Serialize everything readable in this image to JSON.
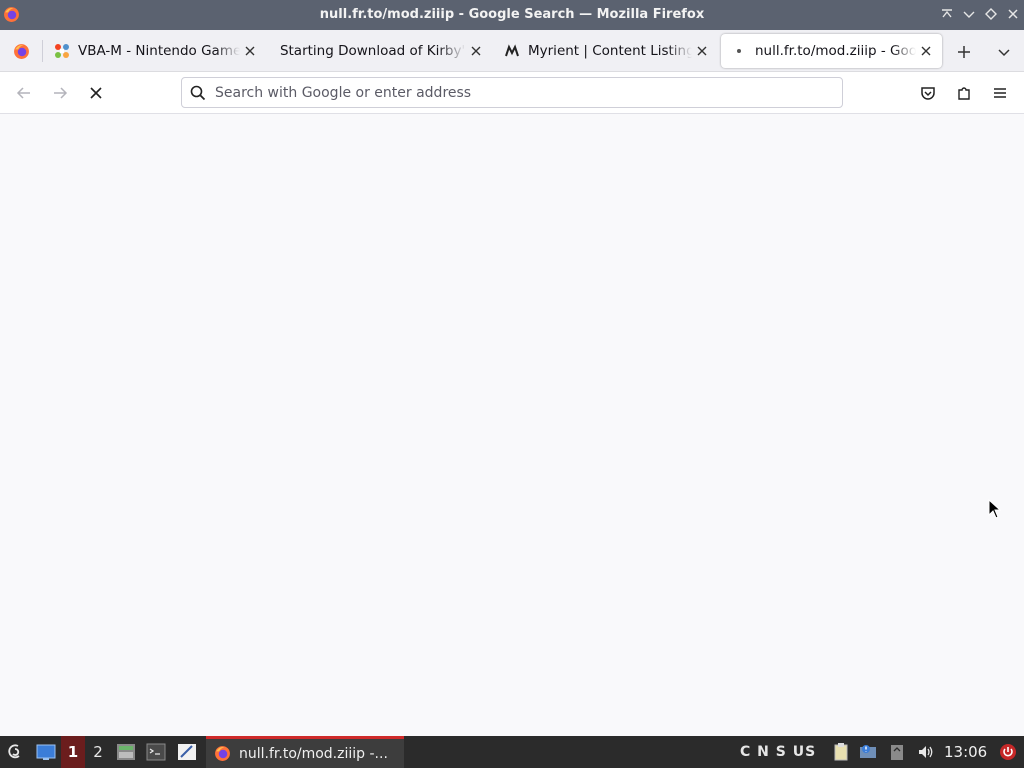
{
  "window": {
    "title": "null.fr.to/mod.ziiip - Google Search — Mozilla Firefox"
  },
  "tabs": [
    {
      "label": "VBA-M - Nintendo GameBoy",
      "icon": "joomla-icon",
      "active": false
    },
    {
      "label": "Starting Download of Kirby's",
      "icon": "none",
      "active": false
    },
    {
      "label": "Myrient | Content Listing",
      "icon": "myrient-icon",
      "active": false
    },
    {
      "label": "null.fr.to/mod.ziiip - Google",
      "icon": "loading-dot-icon",
      "active": true
    }
  ],
  "urlbar": {
    "placeholder": "Search with Google or enter address",
    "value": ""
  },
  "taskbar": {
    "workspaces": [
      "1",
      "2"
    ],
    "active_workspace": "1",
    "task_label": "null.fr.to/mod.ziiip -...",
    "lock_indicators": "C N S US",
    "clock": "13:06"
  },
  "colors": {
    "titlebar": "#5b6270",
    "tabstrip": "#f0f0f4",
    "taskbar": "#2b2b2b",
    "active_workspace": "#6b1d1d",
    "task_accent": "#cf2a2a"
  }
}
